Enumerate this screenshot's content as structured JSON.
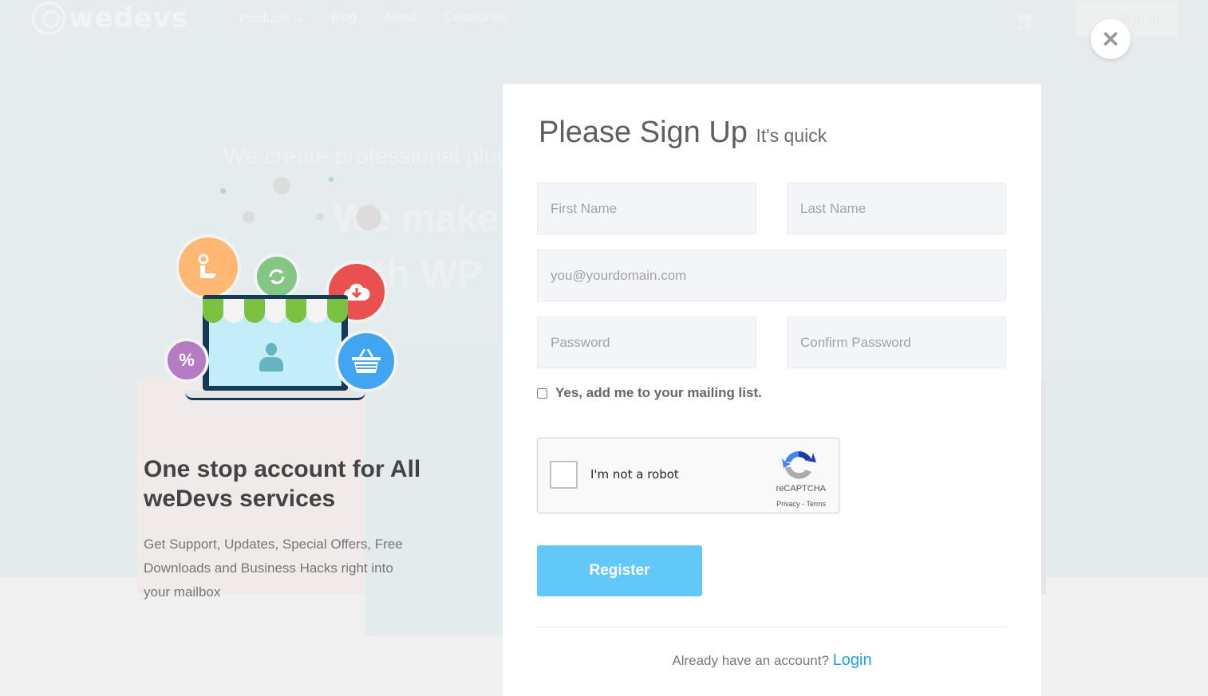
{
  "background": {
    "logo_text": "wedevs",
    "nav": [
      "Products ⌄",
      "Blog",
      "About",
      "Contact Us"
    ],
    "signin_label": "Sign In",
    "hero_sub": "We create professional plug",
    "hero_title_line1": "We make W",
    "hero_title_line2": "with WP"
  },
  "promo": {
    "heading": "One stop account for All weDevs services",
    "body": "Get Support, Updates, Special Offers, Free Downloads and Business Hacks right into your mailbox",
    "icons": [
      "support-icon",
      "sync-icon",
      "cloud-download-icon",
      "percent-icon",
      "basket-icon"
    ],
    "percent_symbol": "%"
  },
  "modal": {
    "title": "Please Sign Up",
    "subtitle": "It's quick",
    "fields": {
      "first_name": {
        "placeholder": "First Name",
        "value": ""
      },
      "last_name": {
        "placeholder": "Last Name",
        "value": ""
      },
      "email": {
        "placeholder": "you@yourdomain.com",
        "value": ""
      },
      "password": {
        "placeholder": "Password",
        "value": ""
      },
      "confirm_password": {
        "placeholder": "Confirm Password",
        "value": ""
      }
    },
    "mailing_label": "Yes, add me to your mailing list.",
    "mailing_checked": false,
    "recaptcha": {
      "label": "I'm not a robot",
      "brand": "reCAPTCHA",
      "links": "Privacy - Terms"
    },
    "register_label": "Register",
    "login_prompt": "Already have an account?",
    "login_link": "Login",
    "close_glyph": "✕"
  },
  "colors": {
    "accent": "#62c8fa",
    "link": "#1ea2e4"
  }
}
